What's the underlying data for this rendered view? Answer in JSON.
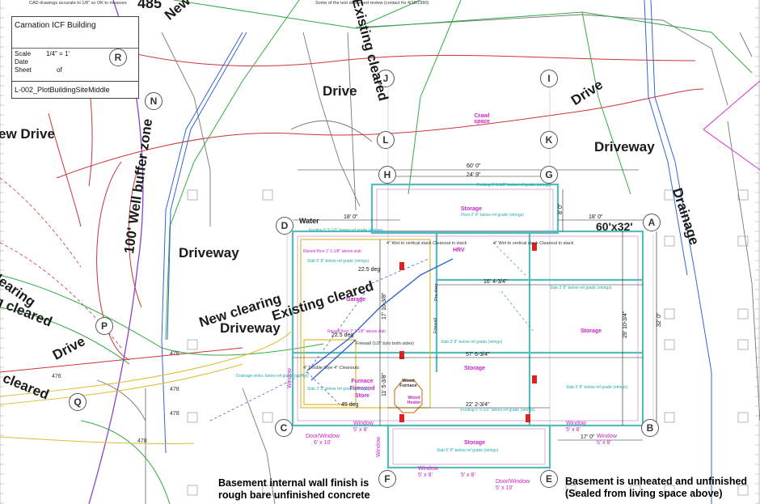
{
  "title_block": {
    "project": "Carnation ICF Building",
    "scale_label": "Scale",
    "scale_value": "1/4\" = 1'",
    "date_label": "Date",
    "sheet_label": "Sheet",
    "sheet_of": "of",
    "sheet_name": "L-002_PlotBuildingSiteMiddle"
  },
  "top_notes": {
    "note1": "CAD drawings accurate to 1/8\" so OK to measure",
    "note2": "Some of the text data need review (contact for 4/18/1990)"
  },
  "grid_labels": [
    "R",
    "N",
    "J",
    "I",
    "L",
    "K",
    "H",
    "G",
    "D",
    "A",
    "P",
    "Q",
    "C",
    "B",
    "F",
    "E"
  ],
  "site_labels": {
    "new_drive": "New Drive",
    "new_drive_partial": "ew Drive",
    "well_buffer": "100' Well buffer zone",
    "existing_cleared": "Existing cleared",
    "drive": "Drive",
    "driveway": "Driveway",
    "drainage": "Drainage",
    "new_clearing": "New clearing",
    "clearing_partial": "clearing",
    "cleared_partial": "g cleared",
    "top_number": "485",
    "water": "Water",
    "crawl_space": "Crawl space"
  },
  "building": {
    "size_label": "60'x32'",
    "dims": {
      "overall_width": "60' 0\"",
      "upper": "24' 9\"",
      "d_water": "18' 0\"",
      "a_top": "18' 0\"",
      "mid": "16' 4-3/4\"",
      "long": "57' 6-3/4\"",
      "lower": "22' 2-3/4\"",
      "right_17": "17' 0\"",
      "vertical_29": "29' 10-3/4\"",
      "vertical_32": "32' 0\"",
      "vertical_8": "8' 0\"",
      "vertical_17": "17' 10-3/8\"",
      "vertical_11": "11' 5-3/8\"",
      "deg1": "22.5 deg",
      "deg2": "22.5 deg",
      "deg3": "45 deg"
    },
    "rooms": {
      "storage": "Storage",
      "garage": "Garage",
      "hrv": "HRV",
      "furnace": "Furnace Firewood Store",
      "wood_furnace": "Wood Furnace",
      "wood_heater": "Wood Heater",
      "window": "Window",
      "window_size": "5' x 8'",
      "door_window": "Door/Window",
      "door_window_size": "5' x 10'",
      "door_window_size2": "6' x 10'",
      "firewall": "Firewall (1/2\" bylo both sides)",
      "firewall_short": "Firewall",
      "pre_door": "Pre-door"
    },
    "slab_notes": {
      "footing_top": "Footing 5' 5-1/2\" below ref grade (strings)",
      "footing_mid": "Footing 5' 5-1/2\" below ref grade (strings)",
      "slab5": "Slab 5' 8\" below ref grade (strings)",
      "slab3": "Slab 3' 8\" below ref grade (strings)",
      "raised_floor": "Raised floor 2' 1-1/8\" above slab",
      "raised_floor2": "Raised floor 2' 1-1/8\" above slab",
      "floor_below": "Floor 2' 8\" below ref grade (strings)",
      "wet_wall": "4\" Wet to vertical stack Cleanout in stack",
      "dbl_wye": "4\" Double Wye 4\" Cleanouts",
      "drain_note": "Drainage sinks, below ref grade (strings)"
    }
  },
  "contours": [
    "476",
    "476",
    "478",
    "478",
    "478"
  ],
  "notes": {
    "basement_finish_1": "Basement internal wall finish is",
    "basement_finish_2": "rough bare unfinished concrete",
    "basement_heat_1": "Basement is unheated and unfinished",
    "basement_heat_2": "(Sealed from living space above)"
  },
  "colors": {
    "drive_red": "#cc3333",
    "cleared_green": "#33aa44",
    "drainage_blue": "#3366cc",
    "road_gray": "#777777",
    "room_magenta": "#cc22cc",
    "foundation_teal": "#55bbbb",
    "buffer_purple": "#8844cc",
    "path_yellow": "#ddbb33"
  }
}
